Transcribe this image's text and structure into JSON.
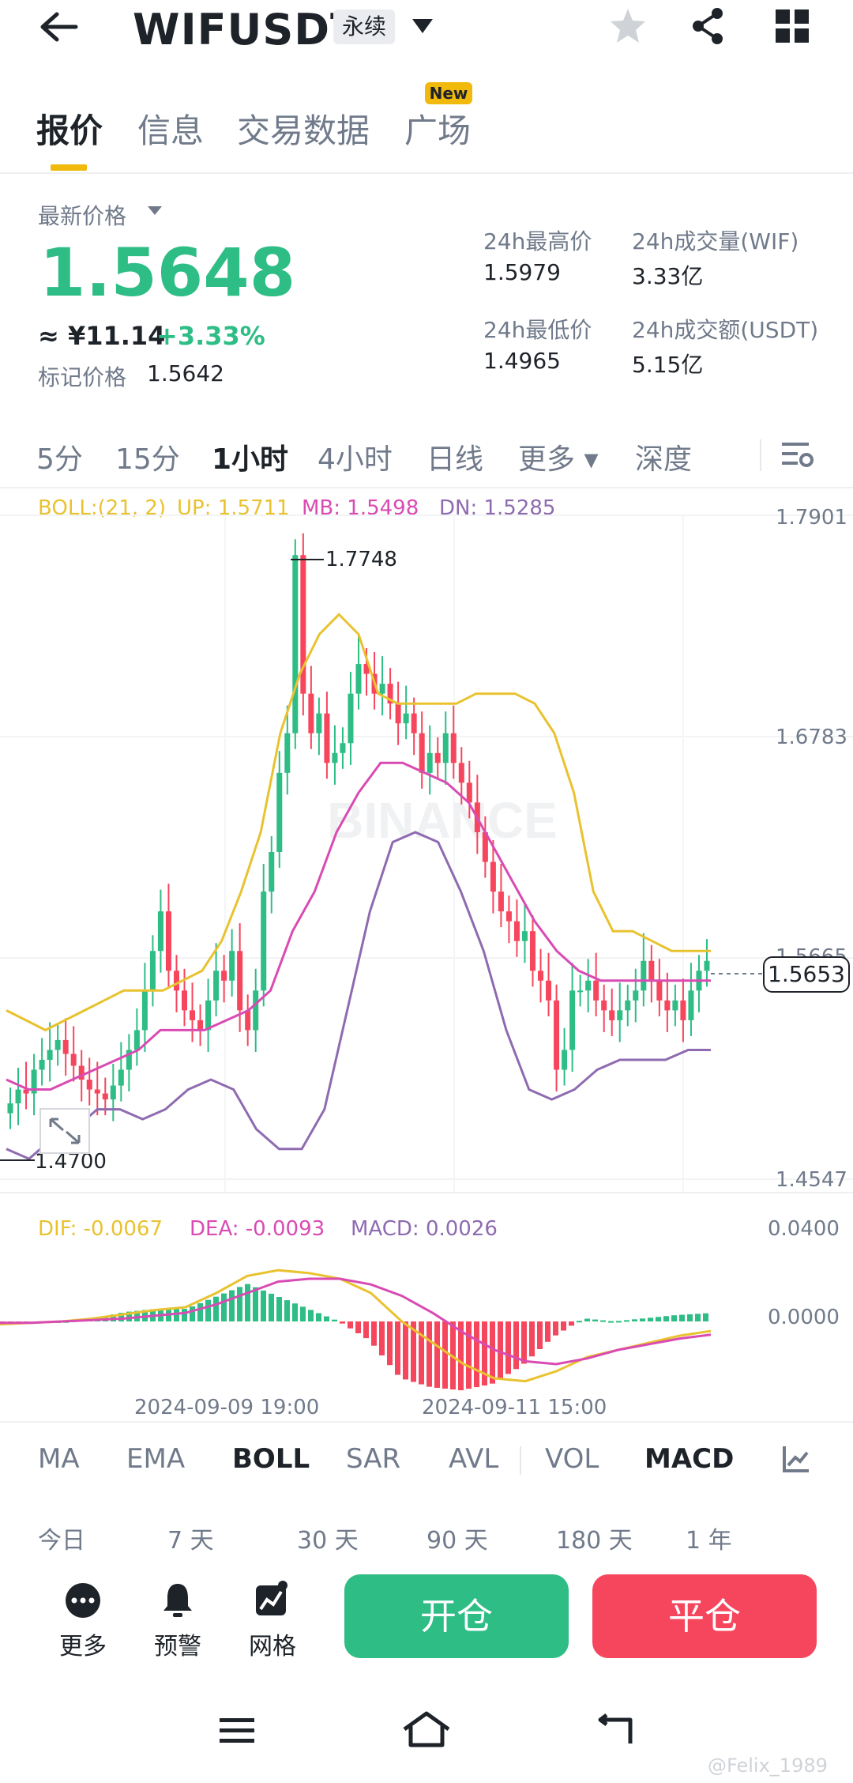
{
  "header": {
    "symbol": "WIFUSDT",
    "contract_type": "永续",
    "icons": [
      "back-arrow-icon",
      "dropdown-triangle-icon",
      "star-icon",
      "share-icon",
      "grid-menu-icon"
    ]
  },
  "tabs": [
    {
      "label": "报价",
      "active": true
    },
    {
      "label": "信息",
      "active": false
    },
    {
      "label": "交易数据",
      "active": false
    },
    {
      "label": "广场",
      "active": false,
      "badge": "New"
    }
  ],
  "price": {
    "latest_label": "最新价格",
    "latest": "1.5648",
    "cny": "≈ ¥11.14",
    "change": "+3.33%",
    "mark_label": "标记价格",
    "mark": "1.5642"
  },
  "stats": {
    "high_label": "24h最高价",
    "high": "1.5979",
    "vol_label": "24h成交量(WIF)",
    "vol": "3.33亿",
    "low_label": "24h最低价",
    "low": "1.4965",
    "amt_label": "24h成交额(USDT)",
    "amt": "5.15亿"
  },
  "intervals": [
    {
      "label": "5分",
      "active": false
    },
    {
      "label": "15分",
      "active": false
    },
    {
      "label": "1小时",
      "active": true
    },
    {
      "label": "4小时",
      "active": false
    },
    {
      "label": "日线",
      "active": false
    },
    {
      "label": "更多 ▾",
      "active": false
    },
    {
      "label": "深度",
      "active": false
    }
  ],
  "boll": {
    "label": "BOLL:(21, 2)",
    "up": "UP: 1.5711",
    "mb": "MB: 1.5498",
    "dn": "DN: 1.5285"
  },
  "price_axis": {
    "top": "1.7901",
    "mid": "1.6783",
    "low2": "1.5665",
    "bottom": "1.4547"
  },
  "annotations": {
    "high": "1.7748",
    "low": "1.4700",
    "current": "1.5653"
  },
  "watermark": "BINANCE",
  "macd": {
    "dif": "DIF: -0.0067",
    "dea": "DEA: -0.0093",
    "macd": "MACD: 0.0026",
    "axis_top": "0.0400",
    "axis_zero": "0.0000"
  },
  "time_axis": [
    "2024-09-09 19:00",
    "2024-09-11 15:00"
  ],
  "indicators": [
    {
      "label": "MA",
      "active": false
    },
    {
      "label": "EMA",
      "active": false
    },
    {
      "label": "BOLL",
      "active": true
    },
    {
      "label": "SAR",
      "active": false
    },
    {
      "label": "AVL",
      "active": false
    },
    {
      "label": "VOL",
      "active": false
    },
    {
      "label": "MACD",
      "active": true
    }
  ],
  "ranges": [
    "今日",
    "7 天",
    "30 天",
    "90 天",
    "180 天",
    "1 年"
  ],
  "actions": {
    "more": "更多",
    "alert": "预警",
    "grid": "网格",
    "open": "开仓",
    "close": "平仓",
    "open_color": "#2ebd85",
    "close_color": "#f6465d"
  },
  "user_watermark": "@Felix_1989",
  "colors": {
    "up": "#2ebd85",
    "down": "#f6465d",
    "boll_up": "#e9c230",
    "boll_mb": "#d94bb3",
    "boll_dn": "#8e6bb0",
    "accent": "#f0b90b"
  },
  "chart_data": {
    "type": "candlestick",
    "interval": "1小时",
    "ylim": [
      1.4547,
      1.7901
    ],
    "close_series": [
      1.493,
      1.5,
      1.498,
      1.51,
      1.515,
      1.52,
      1.525,
      1.518,
      1.512,
      1.505,
      1.5,
      1.498,
      1.495,
      1.502,
      1.51,
      1.52,
      1.53,
      1.55,
      1.57,
      1.59,
      1.56,
      1.55,
      1.54,
      1.535,
      1.53,
      1.545,
      1.56,
      1.555,
      1.57,
      1.54,
      1.53,
      1.55,
      1.6,
      1.62,
      1.66,
      1.68,
      1.77,
      1.7,
      1.68,
      1.69,
      1.665,
      1.67,
      1.675,
      1.7,
      1.715,
      1.71,
      1.7,
      1.705,
      1.695,
      1.685,
      1.69,
      1.68,
      1.66,
      1.67,
      1.665,
      1.68,
      1.665,
      1.655,
      1.645,
      1.63,
      1.615,
      1.6,
      1.59,
      1.585,
      1.575,
      1.58,
      1.56,
      1.555,
      1.545,
      1.51,
      1.52,
      1.55,
      1.55,
      1.555,
      1.545,
      1.54,
      1.535,
      1.54,
      1.545,
      1.55,
      1.565,
      1.555,
      1.545,
      1.54,
      1.545,
      1.535,
      1.55,
      1.56,
      1.565
    ],
    "boll_up_series": [
      1.54,
      1.535,
      1.53,
      1.535,
      1.54,
      1.545,
      1.55,
      1.55,
      1.55,
      1.555,
      1.56,
      1.575,
      1.6,
      1.63,
      1.68,
      1.71,
      1.73,
      1.74,
      1.73,
      1.7,
      1.695,
      1.695,
      1.695,
      1.695,
      1.7,
      1.7,
      1.7,
      1.695,
      1.68,
      1.65,
      1.6,
      1.58,
      1.58,
      1.575,
      1.57,
      1.57,
      1.57
    ],
    "boll_mb_series": [
      1.505,
      1.5,
      1.5,
      1.505,
      1.51,
      1.515,
      1.52,
      1.53,
      1.53,
      1.53,
      1.535,
      1.54,
      1.55,
      1.58,
      1.6,
      1.63,
      1.65,
      1.665,
      1.665,
      1.66,
      1.655,
      1.645,
      1.625,
      1.605,
      1.585,
      1.57,
      1.56,
      1.555,
      1.555,
      1.555,
      1.555,
      1.555,
      1.555
    ],
    "boll_dn_series": [
      1.47,
      1.465,
      1.475,
      1.48,
      1.49,
      1.49,
      1.485,
      1.49,
      1.5,
      1.505,
      1.5,
      1.48,
      1.47,
      1.47,
      1.49,
      1.54,
      1.59,
      1.625,
      1.63,
      1.625,
      1.6,
      1.57,
      1.53,
      1.5,
      1.495,
      1.5,
      1.51,
      1.515,
      1.515,
      1.515,
      1.52,
      1.52
    ],
    "macd_dif_series": [
      -0.002,
      -0.001,
      0.0,
      0.002,
      0.005,
      0.008,
      0.01,
      0.02,
      0.032,
      0.036,
      0.034,
      0.03,
      0.02,
      0.0,
      -0.015,
      -0.03,
      -0.04,
      -0.042,
      -0.035,
      -0.025,
      -0.02,
      -0.015,
      -0.01,
      -0.0067
    ],
    "macd_dea_series": [
      -0.001,
      -0.001,
      0.0,
      0.001,
      0.002,
      0.004,
      0.006,
      0.012,
      0.02,
      0.028,
      0.03,
      0.03,
      0.026,
      0.018,
      0.006,
      -0.008,
      -0.02,
      -0.028,
      -0.03,
      -0.026,
      -0.02,
      -0.016,
      -0.012,
      -0.0093
    ]
  }
}
